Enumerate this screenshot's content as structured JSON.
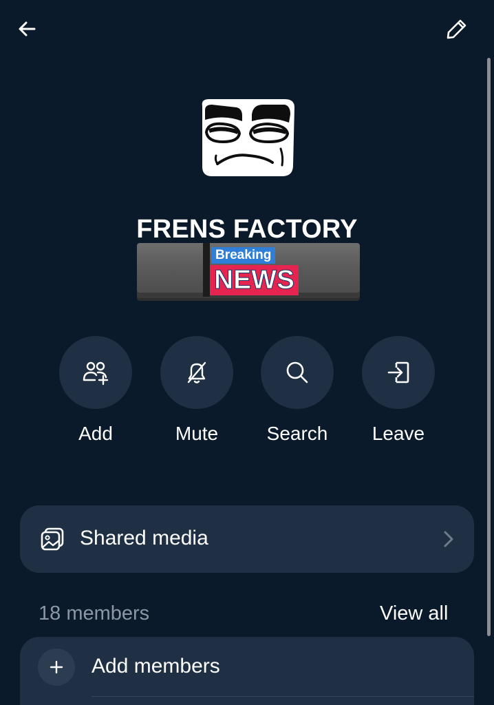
{
  "header": {
    "back_icon": "arrow-left-icon",
    "edit_icon": "pencil-icon"
  },
  "group": {
    "name": "FRENS FACTORY",
    "avatar_icon": "meme-face-avatar",
    "banner": {
      "small_text": "Breaking",
      "big_text": "NEWS",
      "small_bg": "#2f7fd8",
      "big_bg": "#e5254f"
    }
  },
  "actions": [
    {
      "label": "Add",
      "icon": "add-people-icon"
    },
    {
      "label": "Mute",
      "icon": "bell-muted-icon"
    },
    {
      "label": "Search",
      "icon": "search-icon"
    },
    {
      "label": "Leave",
      "icon": "leave-icon"
    }
  ],
  "shared_media": {
    "label": "Shared media",
    "icon": "photos-icon",
    "chevron": "chevron-right-icon"
  },
  "members": {
    "count_label": "18 members",
    "view_all_label": "View all",
    "add_label": "Add members",
    "add_icon": "plus-icon"
  },
  "colors": {
    "background": "#0b1a2a",
    "surface": "#1f3044",
    "text": "#ffffff",
    "muted_text": "#8b97a5"
  }
}
